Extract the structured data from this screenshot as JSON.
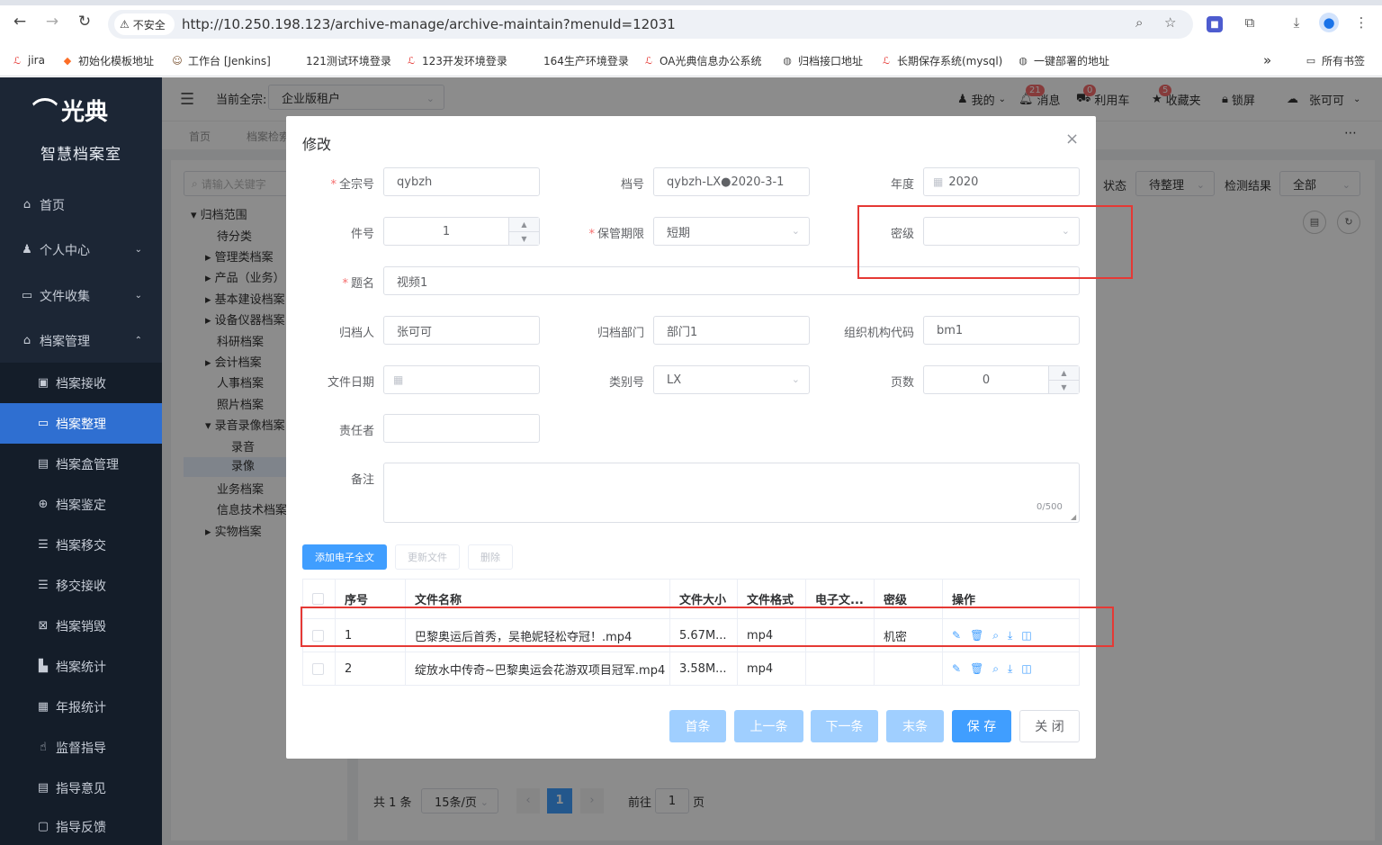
{
  "browser": {
    "security_label": "不安全",
    "url": "http://10.250.198.123/archive-manage/archive-maintain?menuId=12031",
    "bookmarks": [
      "jira",
      "初始化模板地址",
      "工作台 [Jenkins]",
      "121测试环境登录",
      "123开发环境登录",
      "164生产环境登录",
      "OA光典信息办公系统",
      "归档接口地址",
      "长期保存系统(mysql)",
      "一键部署的地址"
    ],
    "all_bookmarks": "所有书签",
    "more": "»"
  },
  "app": {
    "logo": "光典",
    "subtitle": "智慧档案室",
    "topbar": {
      "current_label": "当前全宗:",
      "current_value": "企业版租户",
      "mine": "我的",
      "msg_badge": "21",
      "msg": "消息",
      "cart_badge": "0",
      "cart": "利用车",
      "fav_badge": "5",
      "fav": "收藏夹",
      "lock": "锁屏",
      "user": "张可可"
    },
    "breadcrumbs": [
      "首页",
      "档案检索"
    ]
  },
  "sidebar": {
    "items": [
      {
        "label": "首页",
        "icon": "home-icon"
      },
      {
        "label": "个人中心",
        "icon": "user-icon"
      },
      {
        "label": "文件收集",
        "icon": "folder-icon"
      },
      {
        "label": "档案管理",
        "icon": "archive-icon"
      },
      {
        "label": "档案接收",
        "icon": "receive-icon"
      },
      {
        "label": "档案整理",
        "icon": "folder-icon"
      },
      {
        "label": "档案盒管理",
        "icon": "box-icon"
      },
      {
        "label": "档案鉴定",
        "icon": "appraise-icon"
      },
      {
        "label": "档案移交",
        "icon": "list-icon"
      },
      {
        "label": "移交接收",
        "icon": "list-icon"
      },
      {
        "label": "档案销毁",
        "icon": "destroy-icon"
      },
      {
        "label": "档案统计",
        "icon": "chart-icon"
      },
      {
        "label": "年报统计",
        "icon": "report-icon"
      },
      {
        "label": "监督指导",
        "icon": "hand-icon"
      },
      {
        "label": "指导意见",
        "icon": "note-icon"
      },
      {
        "label": "指导反馈",
        "icon": "feedback-icon"
      }
    ]
  },
  "tree": {
    "search_placeholder": "请输入关键字",
    "nodes": [
      "归档范围",
      "待分类",
      "管理类档案",
      "产品（业务）",
      "基本建设档案",
      "设备仪器档案",
      "科研档案",
      "会计档案",
      "人事档案",
      "照片档案",
      "录音录像档案",
      "录音",
      "录像",
      "业务档案",
      "信息技术档案",
      "实物档案"
    ]
  },
  "list": {
    "status_label": "状态",
    "status_value": "待整理",
    "check_label": "检测结果",
    "check_value": "全部",
    "pager": {
      "total": "共 1 条",
      "page_size": "15条/页",
      "page": "1",
      "goto": "前往",
      "goto_value": "1",
      "goto_unit": "页"
    }
  },
  "dialog": {
    "title": "修改",
    "fields": {
      "qzh_label": "全宗号",
      "qzh_value": "qybzh",
      "dh_label": "档号",
      "dh_value": "qybzh-LX●2020-3-1",
      "nd_label": "年度",
      "nd_value": "2020",
      "jh_label": "件号",
      "jh_value": "1",
      "bgqx_label": "保管期限",
      "bgqx_value": "短期",
      "mj_label": "密级",
      "mj_value": "",
      "tm_label": "题名",
      "tm_value": "视频1",
      "gdr_label": "归档人",
      "gdr_value": "张可可",
      "gdbm_label": "归档部门",
      "gdbm_value": "部门1",
      "zzjg_label": "组织机构代码",
      "zzjg_value": "bm1",
      "wjrq_label": "文件日期",
      "wjrq_value": "",
      "lbh_label": "类别号",
      "lbh_value": "LX",
      "ys_label": "页数",
      "ys_value": "0",
      "zrz_label": "责任者",
      "zrz_value": "",
      "bz_label": "备注",
      "bz_value": "",
      "bz_count": "0/500"
    },
    "buttons": {
      "add": "添加电子全文",
      "update": "更新文件",
      "delete": "删除"
    },
    "table": {
      "headers": [
        "序号",
        "文件名称",
        "文件大小",
        "文件格式",
        "电子文...",
        "密级",
        "操作"
      ],
      "rows": [
        {
          "no": "1",
          "name": "巴黎奥运后首秀，吴艳妮轻松夺冠！.mp4",
          "size": "5.67M...",
          "format": "mp4",
          "doc": "",
          "level": "机密"
        },
        {
          "no": "2",
          "name": "绽放水中传奇~巴黎奥运会花游双项目冠军.mp4",
          "size": "3.58M...",
          "format": "mp4",
          "doc": "",
          "level": ""
        }
      ]
    },
    "footer": {
      "first": "首条",
      "prev": "上一条",
      "next": "下一条",
      "last": "末条",
      "save": "保 存",
      "close": "关 闭"
    }
  },
  "colors": {
    "sidebar": "#1c2635",
    "active": "#2f6fd1",
    "primary": "#409eff",
    "highlight": "#e53935"
  }
}
